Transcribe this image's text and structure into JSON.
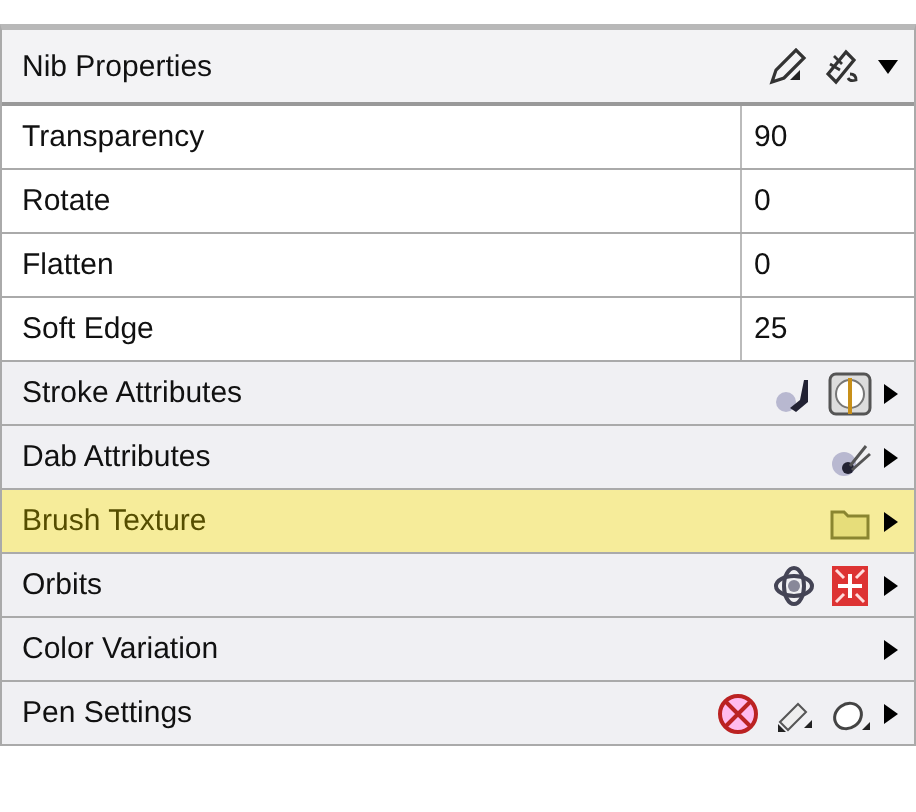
{
  "panel": {
    "title": "Nib Properties",
    "rows": [
      {
        "kind": "property",
        "label": "Transparency",
        "value": "90"
      },
      {
        "kind": "property",
        "label": "Rotate",
        "value": "0"
      },
      {
        "kind": "property",
        "label": "Flatten",
        "value": "0"
      },
      {
        "kind": "property",
        "label": "Soft Edge",
        "value": "25"
      },
      {
        "kind": "section",
        "label": "Stroke Attributes",
        "selected": false
      },
      {
        "kind": "section",
        "label": "Dab Attributes",
        "selected": false
      },
      {
        "kind": "section",
        "label": "Brush Texture",
        "selected": true
      },
      {
        "kind": "section",
        "label": "Orbits",
        "selected": false
      },
      {
        "kind": "section",
        "label": "Color Variation",
        "selected": false
      },
      {
        "kind": "section",
        "label": "Pen Settings",
        "selected": false
      }
    ]
  }
}
